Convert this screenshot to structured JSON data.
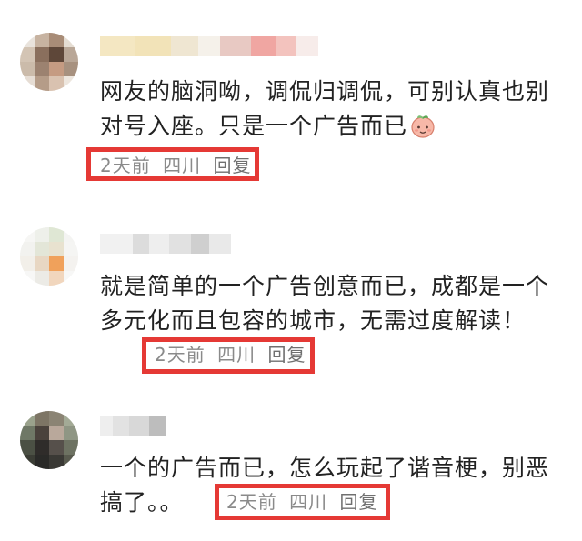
{
  "comments": [
    {
      "text": "网友的脑洞呦，调侃归调侃，可别认真也别对号入座。只是一个广告而已",
      "emoji": "peach-face-emoji",
      "time": "2天前",
      "location": "四川",
      "reply_label": "回复"
    },
    {
      "text": "就是简单的一个广告创意而已，成都是一个多元化而且包容的城市，无需过度解读！",
      "time": "2天前",
      "location": "四川",
      "reply_label": "回复"
    },
    {
      "text": "一个的广告而已，怎么玩起了谐音梗，别恶搞了。。",
      "time": "2天前",
      "location": "四川",
      "reply_label": "回复"
    }
  ],
  "colors": {
    "highlight": "#e53935",
    "text": "#222222",
    "meta": "#8a8a8a"
  }
}
